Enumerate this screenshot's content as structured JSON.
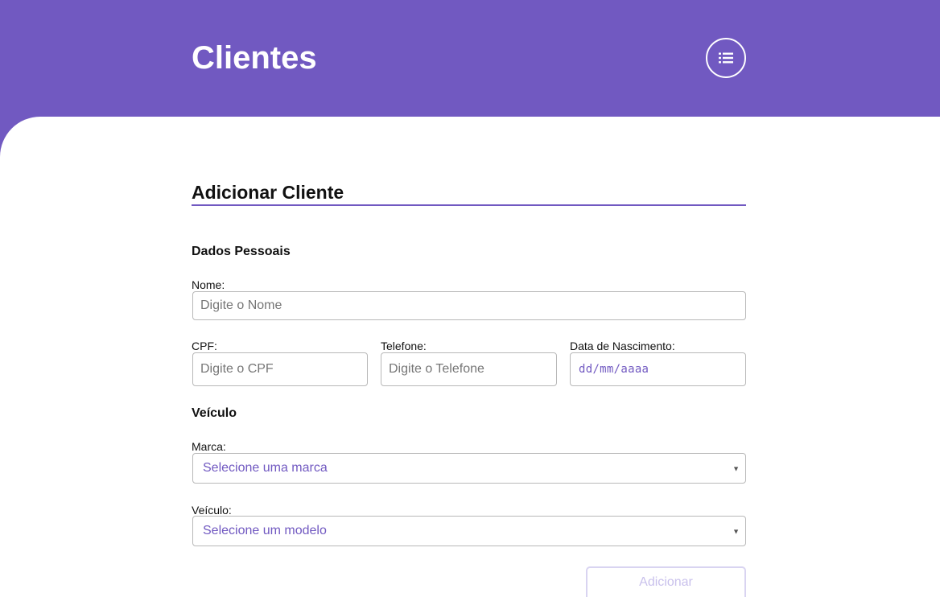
{
  "header": {
    "title": "Clientes",
    "list_icon": "list-icon",
    "background_color": "#7159c1"
  },
  "form": {
    "title": "Adicionar Cliente",
    "personal_section": "Dados Pessoais",
    "name": {
      "label": "Nome:",
      "placeholder": "Digite o Nome",
      "value": ""
    },
    "cpf": {
      "label": "CPF:",
      "placeholder": "Digite o CPF",
      "value": ""
    },
    "phone": {
      "label": "Telefone:",
      "placeholder": "Digite o Telefone",
      "value": ""
    },
    "birth_date": {
      "label": "Data de Nascimento:",
      "placeholder": "dd/mm/aaaa"
    },
    "vehicle_section": "Veículo",
    "brand": {
      "label": "Marca:",
      "selected": "Selecione uma marca"
    },
    "model": {
      "label": "Veículo:",
      "selected": "Selecione um modelo"
    },
    "submit_label": "Adicionar"
  },
  "colors": {
    "accent": "#7159c1",
    "disabled_text": "#c9c1ec"
  }
}
